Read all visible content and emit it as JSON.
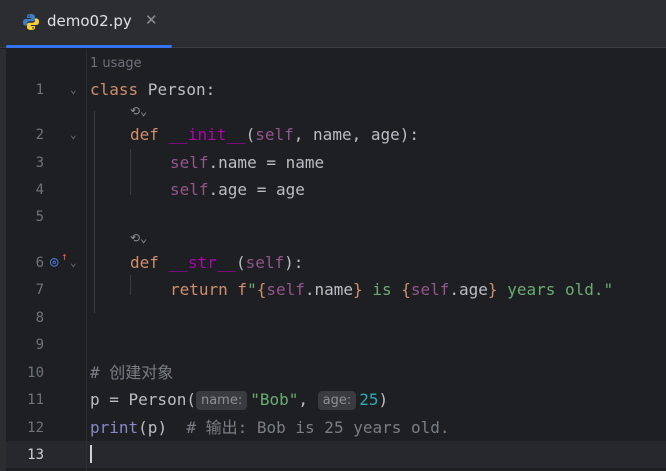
{
  "tab": {
    "filename": "demo02.py",
    "close_glyph": "✕",
    "icon": "python-icon"
  },
  "editor": {
    "usage_hint": "1 usage",
    "line_numbers": [
      "1",
      "2",
      "3",
      "4",
      "5",
      "6",
      "7",
      "8",
      "9",
      "10",
      "11",
      "12",
      "13"
    ],
    "code": {
      "l1_kw": "class",
      "l1_name": " Person:",
      "l2_kw": "def",
      "l2_fn": "__init__",
      "l2_open": "(",
      "l2_self": "self",
      "l2_rest": ", name, age):",
      "l3_self": "self",
      "l3_rest": ".name = name",
      "l4_self": "self",
      "l4_rest": ".age = age",
      "l6_kw": "def",
      "l6_fn": "__str__",
      "l6_open": "(",
      "l6_self": "self",
      "l6_close": "):",
      "l7_kw": "return",
      "l7_f": " f",
      "l7_q1": "\"",
      "l7_b1": "{",
      "l7_self1": "self",
      "l7_attr1": ".name",
      "l7_b2": "}",
      "l7_mid": " is ",
      "l7_b3": "{",
      "l7_self2": "self",
      "l7_attr2": ".age",
      "l7_b4": "}",
      "l7_tail": " years old.\"",
      "l10_comment": "# 创建对象",
      "l11_start": "p = Person(",
      "l11_hint_name": "name:",
      "l11_str": "\"Bob\"",
      "l11_comma": ", ",
      "l11_hint_age": "age:",
      "l11_num": "25",
      "l11_close": ")",
      "l12_builtin": "print",
      "l12_rest": "(p)  ",
      "l12_comment": "# 输出: Bob is 25 years old."
    },
    "lens_glyph": "⟲⌄",
    "override_glyph": "◎",
    "override_arrow": "↑",
    "fold_glyph": "⌄"
  },
  "colors": {
    "background": "#1e1f22",
    "keyword": "#cf8e6d",
    "self": "#94558d",
    "string": "#6aab73",
    "number": "#2aacb8",
    "comment": "#7a7e85",
    "accent": "#3574f0"
  }
}
